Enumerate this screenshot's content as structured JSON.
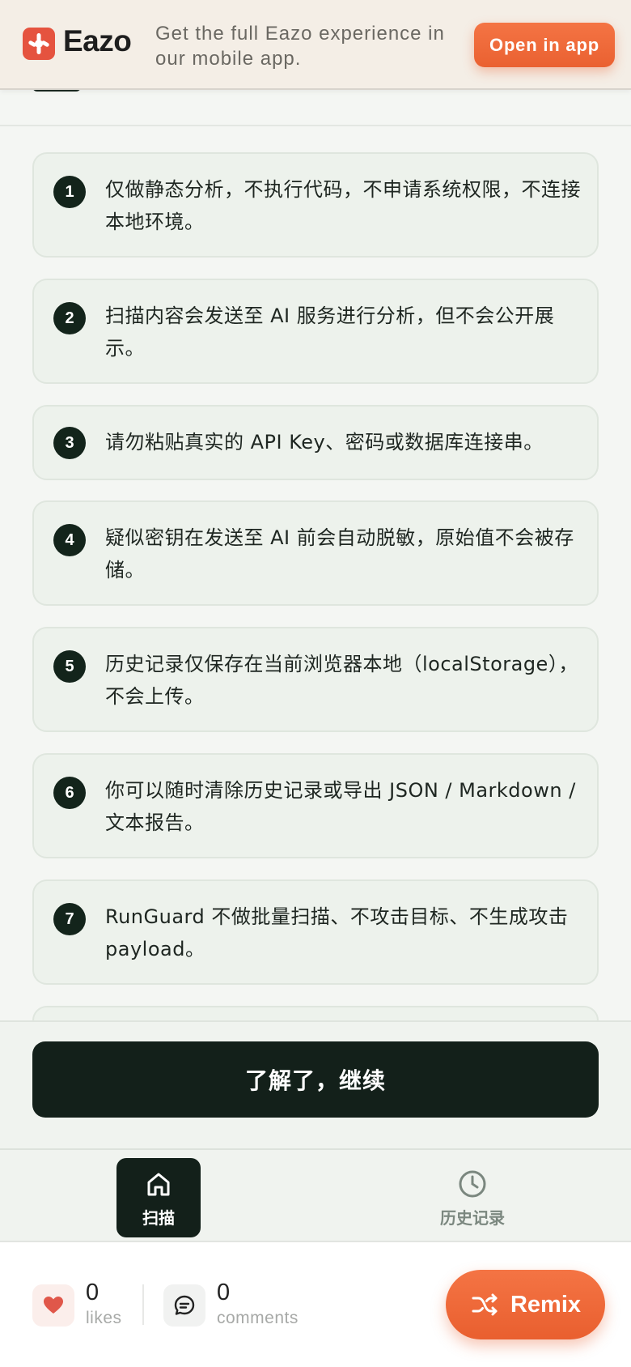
{
  "banner": {
    "brand": "Eazo",
    "text": "Get the full Eazo experience in our mobile app.",
    "open_label": "Open in app"
  },
  "items": [
    {
      "num": "1",
      "text": "仅做静态分析，不执行代码，不申请系统权限，不连接本地环境。"
    },
    {
      "num": "2",
      "text": "扫描内容会发送至 AI 服务进行分析，但不会公开展示。"
    },
    {
      "num": "3",
      "text": "请勿粘贴真实的 API Key、密码或数据库连接串。"
    },
    {
      "num": "4",
      "text": "疑似密钥在发送至 AI 前会自动脱敏，原始值不会被存储。"
    },
    {
      "num": "5",
      "text": "历史记录仅保存在当前浏览器本地（localStorage），不会上传。"
    },
    {
      "num": "6",
      "text": "你可以随时清除历史记录或导出 JSON / Markdown / 文本报告。"
    },
    {
      "num": "7",
      "text": "RunGuard 不做批量扫描、不攻击目标、不生成攻击 payload。"
    }
  ],
  "continue_label": "了解了，继续",
  "tabs": {
    "scan": "扫描",
    "history": "历史记录"
  },
  "footer": {
    "likes_count": "0",
    "likes_label": "likes",
    "comments_count": "0",
    "comments_label": "comments",
    "remix_label": "Remix"
  },
  "colors": {
    "accent": "#ea6131",
    "dark": "#13201a",
    "card": "#edf2ec"
  }
}
